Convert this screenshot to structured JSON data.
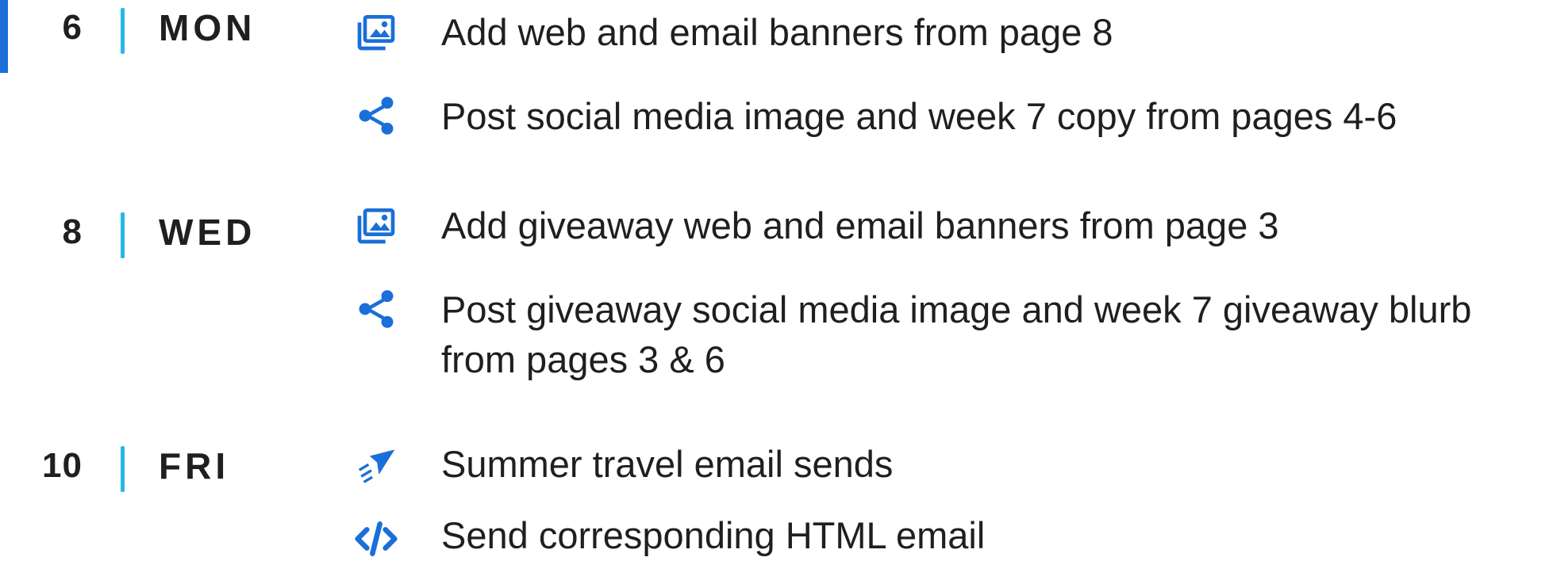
{
  "accent_color": "#1a6fd8",
  "separator_color": "#24b8e6",
  "days": [
    {
      "number": "6",
      "name": "MON",
      "tasks": [
        {
          "icon": "image-gallery-icon",
          "text": "Add web and email banners from page 8"
        },
        {
          "icon": "share-icon",
          "text": "Post social media image and week 7 copy from pages 4-6"
        }
      ]
    },
    {
      "number": "8",
      "name": "WED",
      "tasks": [
        {
          "icon": "image-gallery-icon",
          "text": "Add giveaway web and email banners from page 3"
        },
        {
          "icon": "share-icon",
          "text": "Post giveaway social media image and week 7 giveaway blurb from pages 3 & 6"
        }
      ]
    },
    {
      "number": "10",
      "name": "FRI",
      "tasks": [
        {
          "icon": "send-plane-icon",
          "text": "Summer travel email sends"
        },
        {
          "icon": "code-icon",
          "text": "Send corresponding HTML email"
        }
      ]
    }
  ]
}
